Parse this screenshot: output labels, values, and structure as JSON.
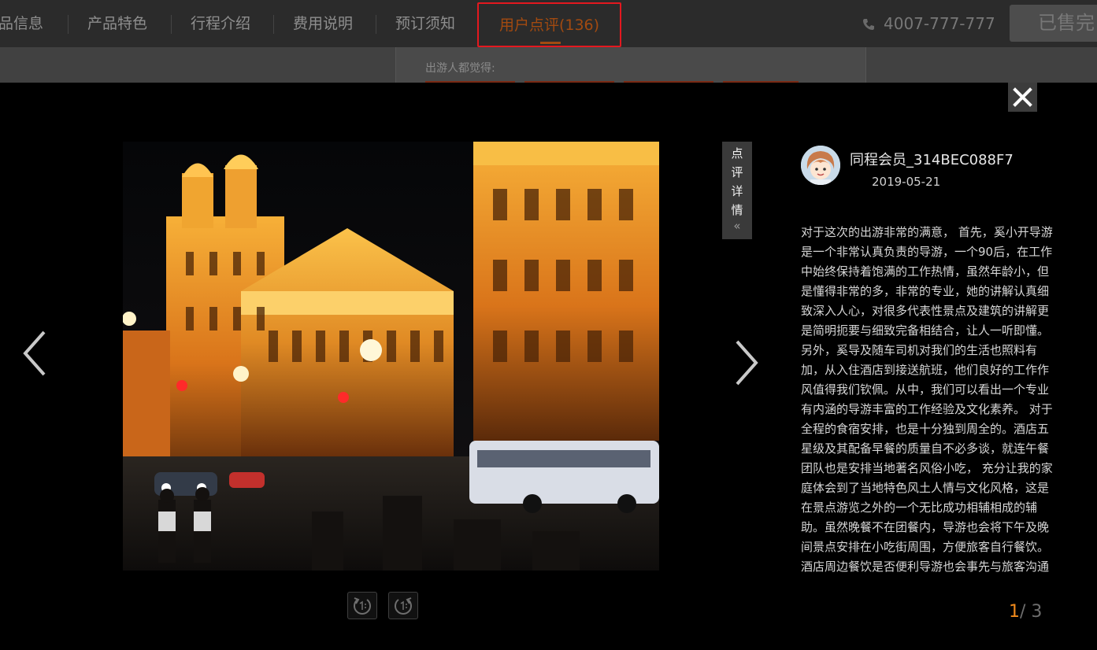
{
  "nav": {
    "tabs": [
      "品信息",
      "产品特色",
      "行程介绍",
      "费用说明",
      "预订须知"
    ],
    "active_tab": "用户点评(136)",
    "phone": "4007-777-777",
    "book_button": "已售完"
  },
  "page_behind": {
    "label": "出游人都觉得:"
  },
  "viewer": {
    "detail_tab_chars": [
      "点",
      "评",
      "详",
      "情"
    ],
    "detail_tab_chevron": "«",
    "review": {
      "username": "同程会员_314BEC088F7",
      "date": "2019-05-21",
      "lines": [
        "对于这次的出游非常的满意， 首先，奚小开导游",
        "是一个非常认真负责的导游，一个90后，在工作",
        "中始终保持着饱满的工作热情，虽然年龄小，但",
        "是懂得非常的多，非常的专业，她的讲解认真细",
        "致深入人心，对很多代表性景点及建筑的讲解更",
        "是简明扼要与细致完备相结合，让人一听即懂。",
        "另外，奚导及随车司机对我们的生活也照料有",
        "加，从入住酒店到接送航班，他们良好的工作作",
        "风值得我们钦佩。从中，我们可以看出一个专业",
        "有内涵的导游丰富的工作经验及文化素养。 对于",
        "全程的食宿安排，也是十分独到周全的。酒店五",
        "星级及其配备早餐的质量自不必多谈，就连午餐",
        "团队也是安排当地著名风俗小吃， 充分让我的家",
        "庭体会到了当地特色风土人情与文化风格，这是",
        "在景点游览之外的一个无比成功相辅相成的辅",
        "助。虽然晚餐不在团餐内，导游也会将下午及晚",
        "间景点安排在小吃街周围，方便旅客自行餐饮。",
        "酒店周边餐饮是否便利导游也会事先与旅客沟通"
      ]
    },
    "counter_current": "1",
    "counter_total": "/ 3"
  },
  "colors": {
    "active_tab": "#a24a10",
    "highlight_border": "#e4181f",
    "counter_current": "#f08a1c"
  }
}
